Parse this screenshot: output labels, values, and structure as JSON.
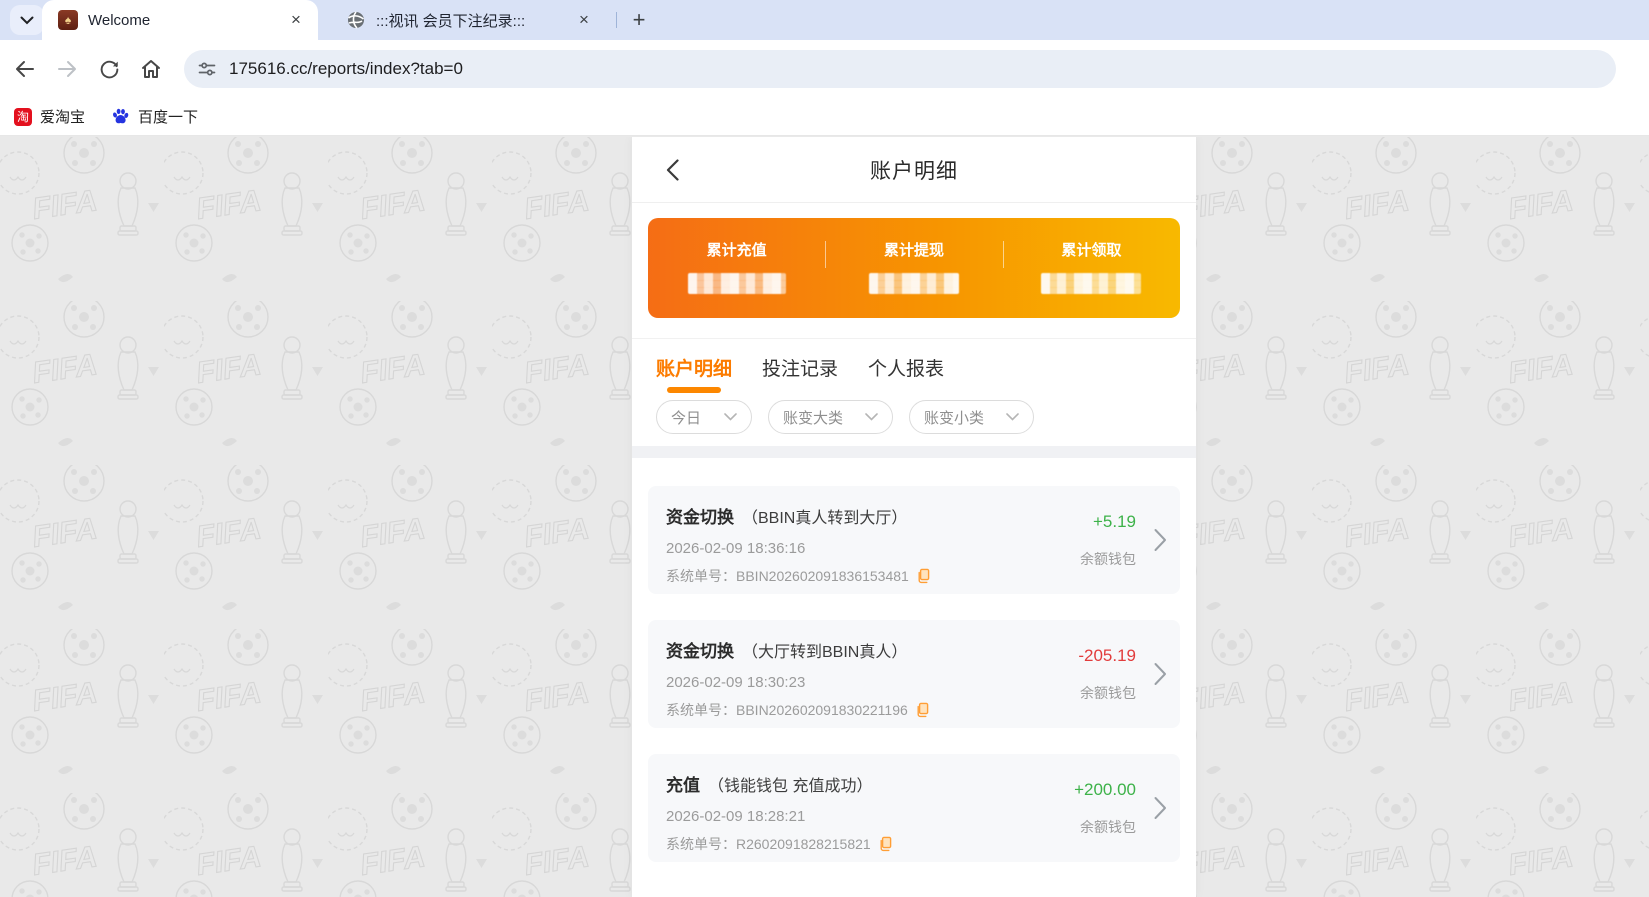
{
  "browser": {
    "tabs": [
      {
        "title": "Welcome",
        "favicon": "casino-logo-icon"
      },
      {
        "title": ":::视讯 会员下注纪录:::",
        "favicon": "globe-icon"
      }
    ],
    "url": "175616.cc/reports/index?tab=0",
    "bookmarks": [
      {
        "label": "爱淘宝",
        "icon": "taobao-icon"
      },
      {
        "label": "百度一下",
        "icon": "baidu-paw-icon"
      }
    ]
  },
  "icons": {
    "tab_close": "×",
    "new_tab": "+",
    "spade": "♠",
    "taobao_glyph": "淘"
  },
  "page": {
    "header": {
      "title": "账户明细"
    },
    "summary": {
      "items": [
        {
          "label": "累计充值",
          "value_hidden": true
        },
        {
          "label": "累计提现",
          "value_hidden": true
        },
        {
          "label": "累计领取",
          "value_hidden": true
        }
      ]
    },
    "tabs": [
      {
        "label": "账户明细",
        "active": true
      },
      {
        "label": "投注记录",
        "active": false
      },
      {
        "label": "个人报表",
        "active": false
      }
    ],
    "filters": [
      {
        "label": "今日"
      },
      {
        "label": "账变大类"
      },
      {
        "label": "账变小类"
      }
    ],
    "order_label": "系统单号：",
    "transactions": [
      {
        "type": "资金切换",
        "detail": "（BBIN真人转到大厅）",
        "datetime": "2026-02-09 18:36:16",
        "order_no": "BBIN202602091836153481",
        "amount": "+5.19",
        "wallet": "余额钱包"
      },
      {
        "type": "资金切换",
        "detail": "（大厅转到BBIN真人）",
        "datetime": "2026-02-09 18:30:23",
        "order_no": "BBIN202602091830221196",
        "amount": "-205.19",
        "wallet": "余额钱包"
      },
      {
        "type": "充值",
        "detail": "（钱能钱包 充值成功）",
        "datetime": "2026-02-09 18:28:21",
        "order_no": "R2602091828215821",
        "amount": "+200.00",
        "wallet": "余额钱包"
      }
    ]
  },
  "colors": {
    "accent_orange": "#fc7c01",
    "card_gradient_start": "#f56d15",
    "card_gradient_end": "#f8b900",
    "positive_green": "#3db249",
    "negative_red": "#e23c3c",
    "tab_strip_blue": "#d9e2f6"
  }
}
